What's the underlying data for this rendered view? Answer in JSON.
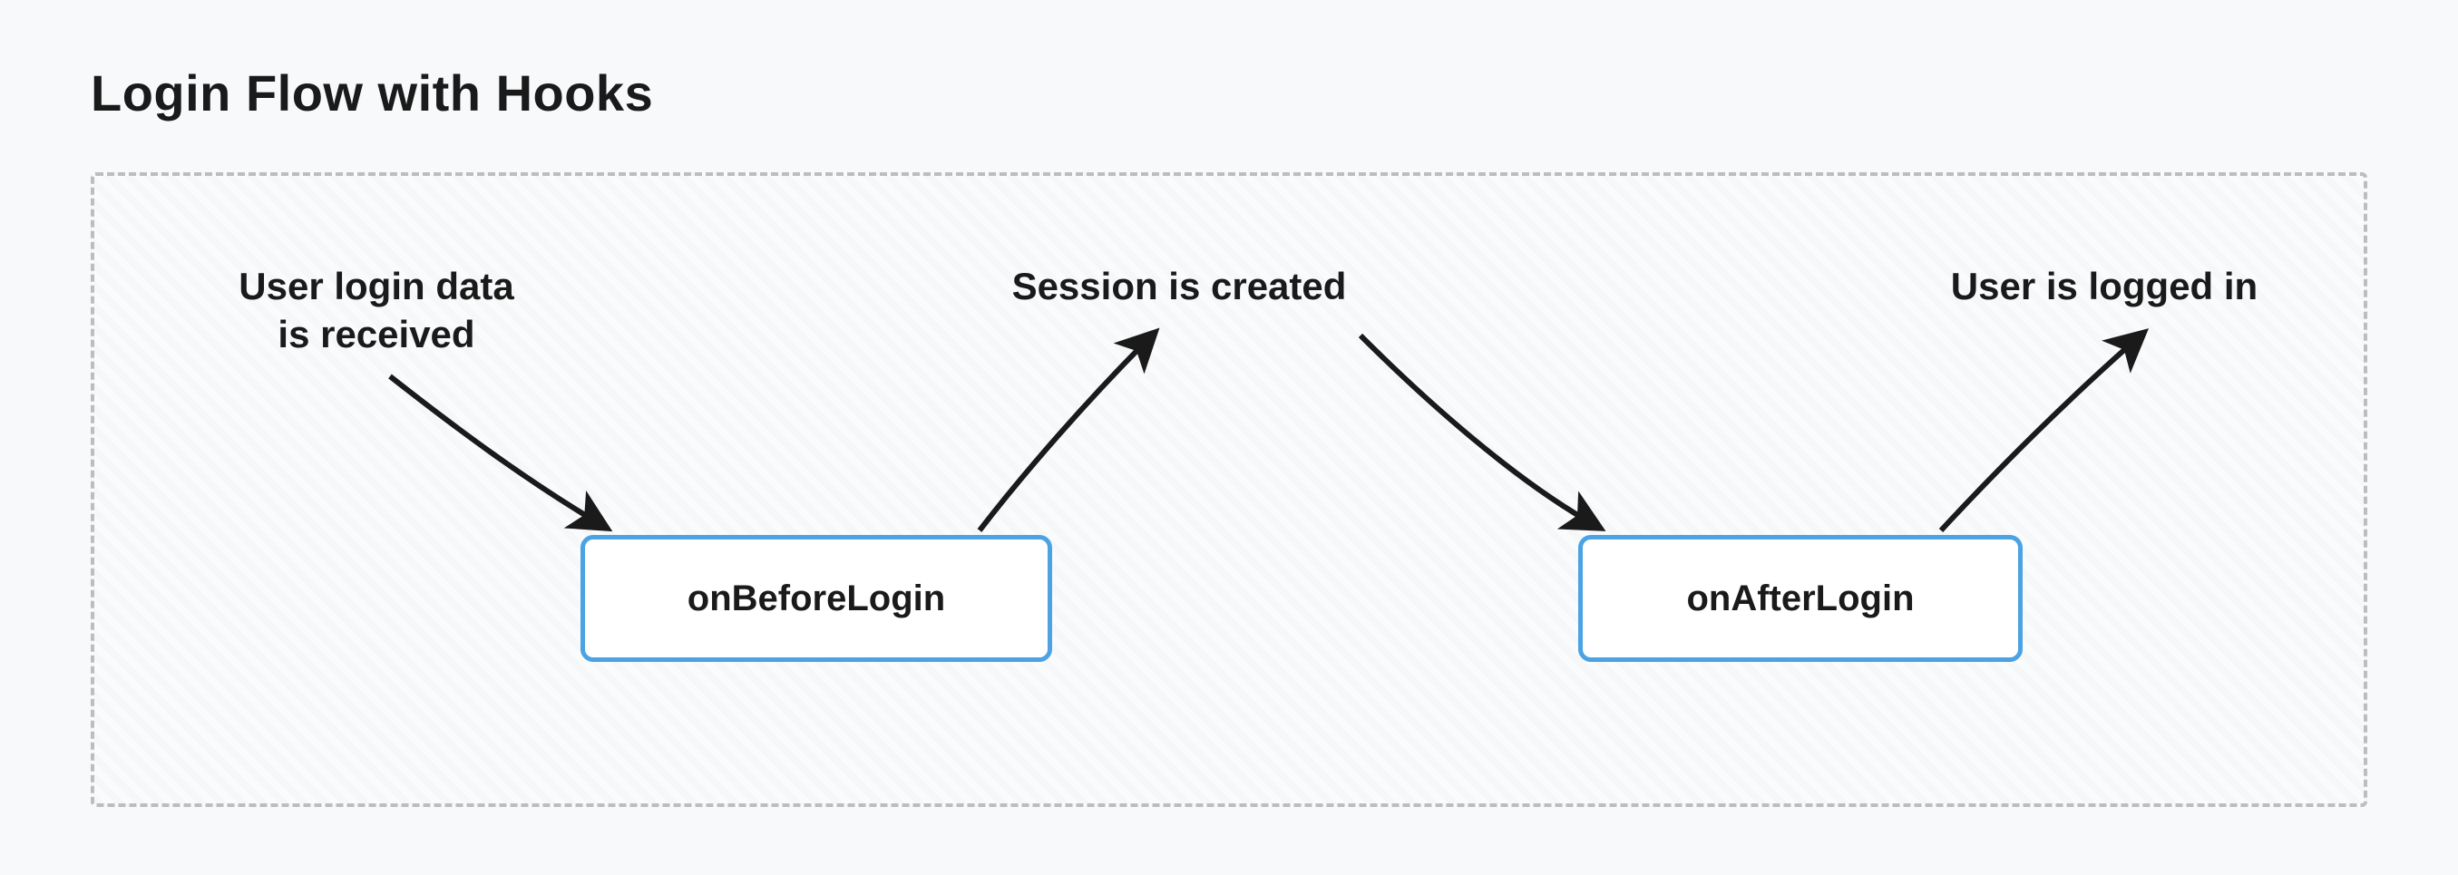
{
  "title": "Login Flow with Hooks",
  "labels": {
    "userLoginData": "User login data\nis received",
    "sessionCreated": "Session is created",
    "userLoggedIn": "User is logged in"
  },
  "hooks": {
    "before": "onBeforeLogin",
    "after": "onAfterLogin"
  },
  "colors": {
    "boxBorder": "#4ba3e3",
    "dashed": "#bdbdbd",
    "text": "#1a1a1a",
    "bg": "#f7f9fb"
  }
}
